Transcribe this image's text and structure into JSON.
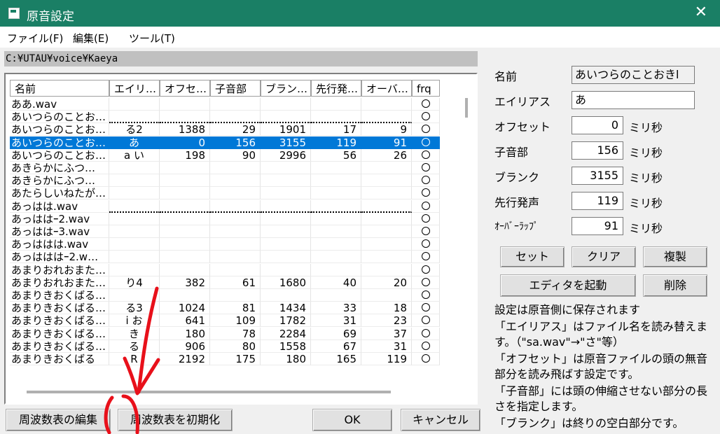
{
  "window": {
    "title": "原音設定",
    "close_glyph": "✕"
  },
  "menu": [
    "ファイル(F)",
    "編集(E)",
    "ツール(T)"
  ],
  "path": "C:¥UTAU¥voice¥Kaeya",
  "columns": [
    "名前",
    "エイリ…",
    "オフセ…",
    "子音部",
    "ブラン…",
    "先行発…",
    "オーバ…",
    "frq"
  ],
  "rows": [
    {
      "name": "ああ.wav",
      "alias": "",
      "offset": "",
      "consonant": "",
      "blank": "",
      "preutter": "",
      "overlap": "",
      "frq": "○",
      "dotted": false,
      "selected": false
    },
    {
      "name": "あいつらのことお…",
      "alias": "",
      "offset": "",
      "consonant": "",
      "blank": "",
      "preutter": "",
      "overlap": "",
      "frq": "○",
      "dotted": true,
      "selected": false
    },
    {
      "name": "あいつらのことお…",
      "alias": "る2",
      "offset": "1388",
      "consonant": "29",
      "blank": "1901",
      "preutter": "17",
      "overlap": "9",
      "frq": "○",
      "dotted": false,
      "selected": false
    },
    {
      "name": "あいつらのことお…",
      "alias": "あ",
      "offset": "0",
      "consonant": "156",
      "blank": "3155",
      "preutter": "119",
      "overlap": "91",
      "frq": "○",
      "dotted": false,
      "selected": true
    },
    {
      "name": "あいつらのことお…",
      "alias": "a い",
      "offset": "198",
      "consonant": "90",
      "blank": "2996",
      "preutter": "56",
      "overlap": "26",
      "frq": "○",
      "dotted": false,
      "selected": false
    },
    {
      "name": "あきらかにふつ…",
      "alias": "",
      "offset": "",
      "consonant": "",
      "blank": "",
      "preutter": "",
      "overlap": "",
      "frq": "○",
      "dotted": false,
      "selected": false
    },
    {
      "name": "あきらかにふつ…",
      "alias": "",
      "offset": "",
      "consonant": "",
      "blank": "",
      "preutter": "",
      "overlap": "",
      "frq": "○",
      "dotted": false,
      "selected": false
    },
    {
      "name": "あたらしいねたが…",
      "alias": "",
      "offset": "",
      "consonant": "",
      "blank": "",
      "preutter": "",
      "overlap": "",
      "frq": "○",
      "dotted": false,
      "selected": false
    },
    {
      "name": "あっはは.wav",
      "alias": "",
      "offset": "",
      "consonant": "",
      "blank": "",
      "preutter": "",
      "overlap": "",
      "frq": "○",
      "dotted": true,
      "selected": false
    },
    {
      "name": "あっははｰ2.wav",
      "alias": "",
      "offset": "",
      "consonant": "",
      "blank": "",
      "preutter": "",
      "overlap": "",
      "frq": "○",
      "dotted": false,
      "selected": false
    },
    {
      "name": "あっははｰ3.wav",
      "alias": "",
      "offset": "",
      "consonant": "",
      "blank": "",
      "preutter": "",
      "overlap": "",
      "frq": "○",
      "dotted": false,
      "selected": false
    },
    {
      "name": "あっははは.wav",
      "alias": "",
      "offset": "",
      "consonant": "",
      "blank": "",
      "preutter": "",
      "overlap": "",
      "frq": "○",
      "dotted": false,
      "selected": false
    },
    {
      "name": "あっはははｰ2.w…",
      "alias": "",
      "offset": "",
      "consonant": "",
      "blank": "",
      "preutter": "",
      "overlap": "",
      "frq": "○",
      "dotted": false,
      "selected": false
    },
    {
      "name": "あまりおれおまた…",
      "alias": "",
      "offset": "",
      "consonant": "",
      "blank": "",
      "preutter": "",
      "overlap": "",
      "frq": "○",
      "dotted": false,
      "selected": false
    },
    {
      "name": "あまりおれおまた…",
      "alias": "り4",
      "offset": "382",
      "consonant": "61",
      "blank": "1680",
      "preutter": "40",
      "overlap": "20",
      "frq": "○",
      "dotted": false,
      "selected": false
    },
    {
      "name": "あまりきおくばる…",
      "alias": "",
      "offset": "",
      "consonant": "",
      "blank": "",
      "preutter": "",
      "overlap": "",
      "frq": "○",
      "dotted": false,
      "selected": false
    },
    {
      "name": "あまりきおくばる…",
      "alias": "る3",
      "offset": "1024",
      "consonant": "81",
      "blank": "1434",
      "preutter": "33",
      "overlap": "18",
      "frq": "○",
      "dotted": false,
      "selected": false
    },
    {
      "name": "あまりきおくばる…",
      "alias": "i お",
      "offset": "641",
      "consonant": "109",
      "blank": "1782",
      "preutter": "31",
      "overlap": "23",
      "frq": "○",
      "dotted": false,
      "selected": false
    },
    {
      "name": "あまりきおくばる…",
      "alias": "き",
      "offset": "180",
      "consonant": "78",
      "blank": "2284",
      "preutter": "69",
      "overlap": "37",
      "frq": "○",
      "dotted": false,
      "selected": false
    },
    {
      "name": "あまりきおくばる…",
      "alias": "る",
      "offset": "906",
      "consonant": "80",
      "blank": "1558",
      "preutter": "67",
      "overlap": "31",
      "frq": "○",
      "dotted": false,
      "selected": false
    },
    {
      "name": "あまりきおくばる",
      "alias": "R",
      "offset": "2192",
      "consonant": "175",
      "blank": "180",
      "preutter": "165",
      "overlap": "119",
      "frq": "○",
      "dotted": false,
      "selected": false
    }
  ],
  "form": {
    "name_label": "名前",
    "name_value": "あいつらのことおきl",
    "alias_label": "エイリアス",
    "alias_value": "あ",
    "offset_label": "オフセット",
    "offset_value": "0",
    "consonant_label": "子音部",
    "consonant_value": "156",
    "blank_label": "ブランク",
    "blank_value": "3155",
    "preutter_label": "先行発声",
    "preutter_value": "119",
    "overlap_label": "ｵｰﾊﾞｰﾗｯﾌﾟ",
    "overlap_value": "91",
    "unit": "ミリ秒"
  },
  "buttons": {
    "set": "セット",
    "clear": "クリア",
    "duplicate": "複製",
    "launch_editor": "エディタを起動",
    "delete": "削除",
    "edit_frq": "周波数表の編集",
    "init_frq": "周波数表を初期化",
    "ok": "OK",
    "cancel": "キャンセル"
  },
  "help": [
    "設定は原音側に保存されます",
    "「エイリアス」はファイル名を読み替えます。（\"sa.wav\"→\"さ\"等）",
    "「オフセット」は原音ファイルの頭の無音部分を読み飛ばす設定です。",
    "「子音部」には頭の伸縮させない部分の長さを指定します。",
    "「ブランク」は終りの空白部分です。"
  ],
  "annotation": {
    "color": "#e8101a",
    "description": "red-arrow-and-circle"
  },
  "colors": {
    "titlebar": "#1a7f65",
    "selection": "#0078d7"
  }
}
